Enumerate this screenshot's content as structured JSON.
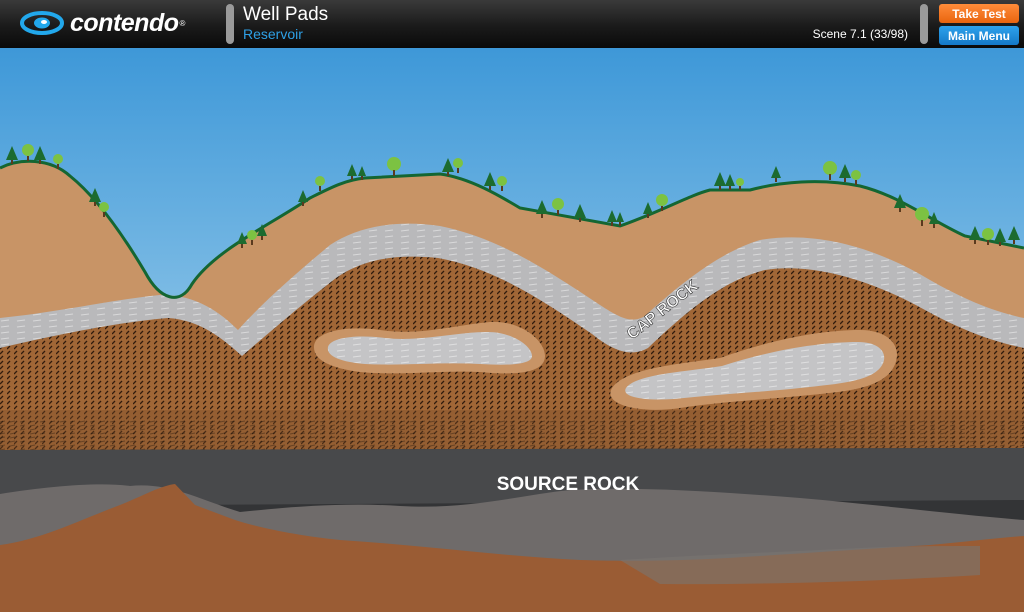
{
  "app": {
    "logo_text": "contendo",
    "logo_mark": "®",
    "title": "Well Pads",
    "subtitle": "Reservoir",
    "scene_label": "Scene 7.1 (33/98)",
    "take_test_label": "Take Test",
    "main_menu_label": "Main Menu"
  },
  "colors": {
    "take_test": "#f07a1e",
    "main_menu": "#1f8fe0",
    "subtitle": "#2ea0e6"
  },
  "illustration": {
    "cap_rock_label": "CAP ROCK",
    "source_rock_label": "SOURCE ROCK"
  }
}
